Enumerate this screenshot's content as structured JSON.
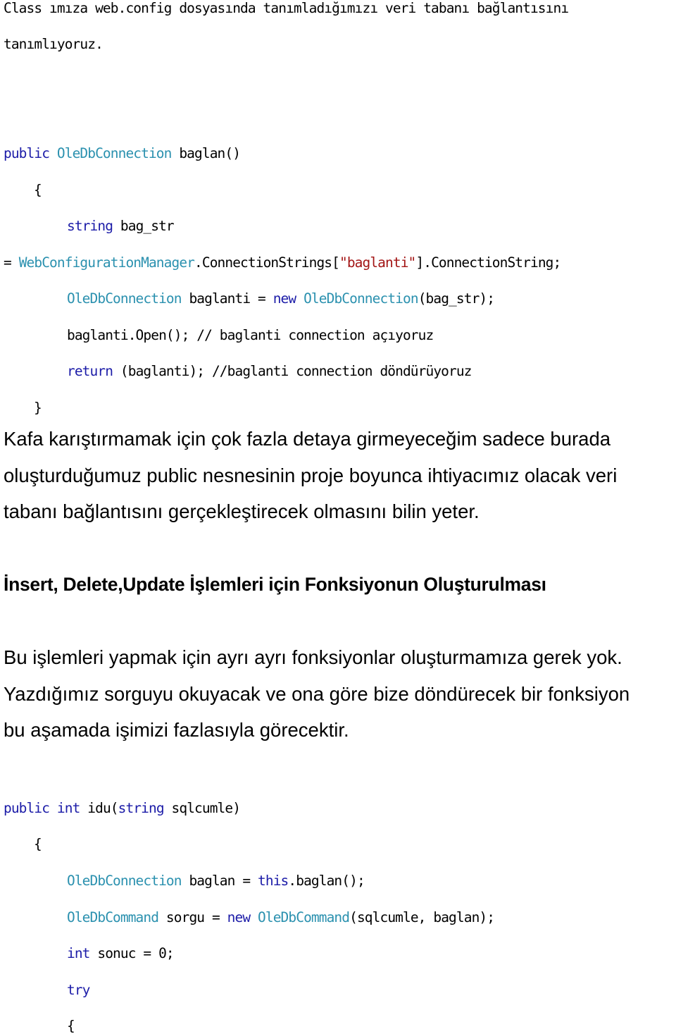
{
  "intro": {
    "line1": "Class ımıza web.config dosyasında tanımladığımızı veri tabanı bağlantısını",
    "line2": "tanımlıyoruz."
  },
  "code1": {
    "sig_kw": "public",
    "sig_type": "OleDbConnection",
    "sig_rest": " baglan()",
    "open_brace": "{",
    "l1_kw": "string",
    "l1_rest": " bag_str",
    "l2_eq": "= ",
    "l2_type": "WebConfigurationManager",
    "l2_mid": ".ConnectionStrings[",
    "l2_str": "\"baglanti\"",
    "l2_end": "].ConnectionString;",
    "l3_type": "OleDbConnection",
    "l3_mid": " baglanti = ",
    "l3_kw": "new",
    "l3_type2": "OleDbConnection",
    "l3_end": "(bag_str);",
    "l4": "baglanti.Open(); // baglanti connection açıyoruz",
    "l5_kw": "return",
    "l5_rest": " (baglanti); //baglanti connection döndürüyoruz",
    "close_brace": "}"
  },
  "para1": {
    "line1": "Kafa karıştırmamak için çok fazla detaya girmeyeceğim sadece burada",
    "line2": "oluşturduğumuz public nesnesinin proje boyunca ihtiyacımız olacak veri",
    "line3": "tabanı bağlantısını gerçekleştirecek olmasını bilin yeter."
  },
  "heading": "İnsert, Delete,Update İşlemleri için Fonksiyonun Oluşturulması",
  "para2": {
    "line1": "Bu işlemleri yapmak için ayrı ayrı fonksiyonlar oluşturmamıza gerek yok.",
    "line2": "Yazdığımız sorguyu okuyacak ve ona göre bize döndürecek bir fonksiyon",
    "line3": "bu aşamada işimizi fazlasıyla görecektir."
  },
  "code2": {
    "sig_kw1": "public",
    "sig_kw2": "int",
    "sig_mid": " idu(",
    "sig_kw3": "string",
    "sig_end": " sqlcumle)",
    "open_brace": "{",
    "l1_type": "OleDbConnection",
    "l1_mid": " baglan = ",
    "l1_kw": "this",
    "l1_end": ".baglan();",
    "l2_type": "OleDbCommand",
    "l2_mid": " sorgu = ",
    "l2_kw": "new",
    "l2_type2": "OleDbCommand",
    "l2_end": "(sqlcumle, baglan);",
    "l3_kw": "int",
    "l3_rest": " sonuc = 0;",
    "l4_kw": "try",
    "l5": "{"
  },
  "colors": {
    "keyword": "#1c1ca8",
    "type": "#2b91af",
    "string": "#a31515",
    "text": "#000000"
  }
}
